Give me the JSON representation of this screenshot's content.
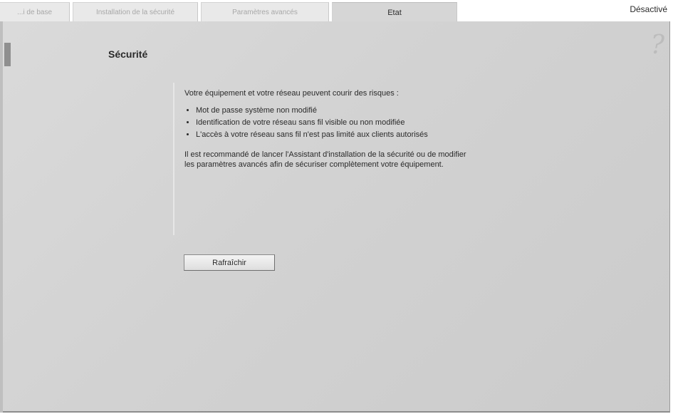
{
  "tabs": [
    {
      "label": "...i de base"
    },
    {
      "label": "Installation de la sécurité"
    },
    {
      "label": "Paramètres avancés"
    },
    {
      "label": "Etat",
      "active": true
    }
  ],
  "header": {
    "status": "Désactivé"
  },
  "icons": {
    "help": "?"
  },
  "section": {
    "title": "Sécurité",
    "intro": "Votre équipement et votre réseau peuvent courir des risques :",
    "risks": [
      "Mot de passe système non modifié",
      "Identification de votre réseau sans fil visible ou non modifiée",
      "L'accès à votre réseau sans fil n'est pas limité aux clients autorisés"
    ],
    "advice": "Il est recommandé de lancer l'Assistant d'installation de la sécurité ou de modifier les paramètres avancés afin de sécuriser complètement votre équipement."
  },
  "buttons": {
    "refresh": "Rafraîchir"
  },
  "colors": {
    "panel": "#d2d2d2",
    "tab_inactive": "#e9e9e9",
    "tab_active": "#d6d6d6"
  }
}
